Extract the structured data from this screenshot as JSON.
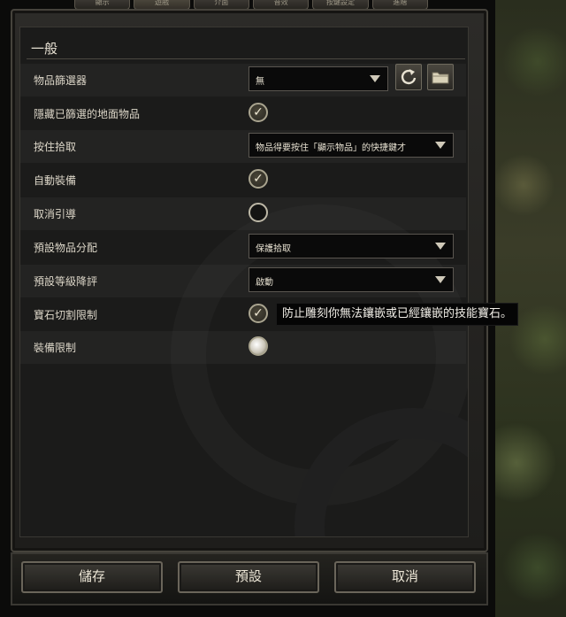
{
  "tabs": [
    "顯示",
    "遊戲",
    "介面",
    "音效",
    "按鍵設定",
    "進階"
  ],
  "section": {
    "title": "一般"
  },
  "rows": {
    "item_filter": {
      "label": "物品篩選器",
      "value": "無"
    },
    "hide_filtered": {
      "label": "隱藏已篩選的地面物品",
      "checked": true
    },
    "hold_pickup": {
      "label": "按住拾取",
      "value": "物品得要按住「顯示物品」的快捷鍵才"
    },
    "auto_equip": {
      "label": "自動裝備",
      "checked": true
    },
    "cancel_guide": {
      "label": "取消引導",
      "checked": false
    },
    "default_alloc": {
      "label": "預設物品分配",
      "value": "保護拾取"
    },
    "default_downgrade": {
      "label": "預設等級降評",
      "value": "啟動"
    },
    "gem_cut_limit": {
      "label": "寶石切割限制",
      "checked": true
    },
    "equip_limit": {
      "label": "裝備限制"
    }
  },
  "tooltip": {
    "text": "防止雕刻你無法鑲嵌或已經鑲嵌的技能寶石。"
  },
  "buttons": {
    "save": "儲存",
    "default": "預設",
    "cancel": "取消"
  },
  "icons": {
    "reset": "reset-icon",
    "folder": "folder-icon"
  }
}
